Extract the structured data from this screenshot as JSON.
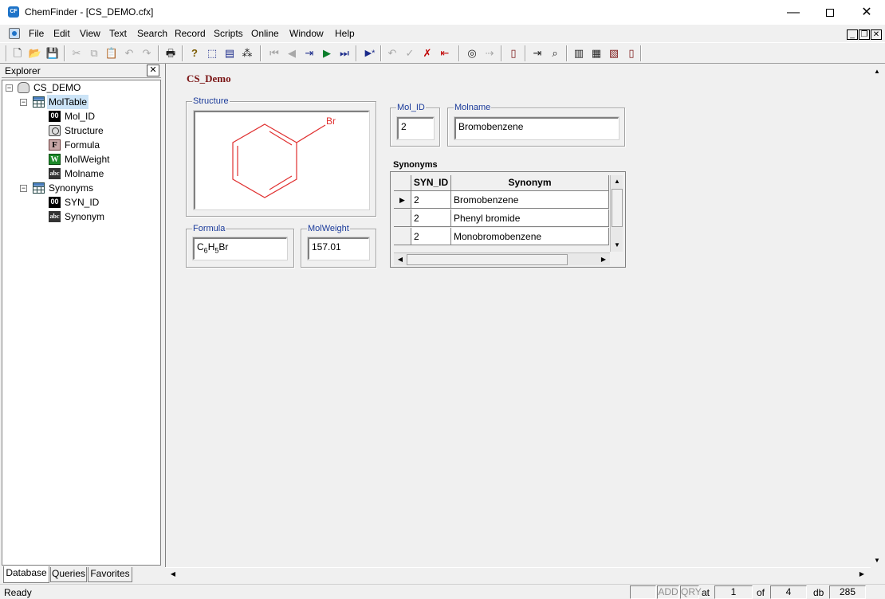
{
  "window": {
    "app_icon": "CF",
    "title": "ChemFinder - [CS_DEMO.cfx]",
    "controls": {
      "minimize": "—",
      "close": "✕"
    }
  },
  "menu": [
    "File",
    "Edit",
    "View",
    "Text",
    "Search",
    "Record",
    "Scripts",
    "Online",
    "Window",
    "Help"
  ],
  "mdi_controls": {
    "minimize": "_",
    "restore": "❐",
    "close": "✕"
  },
  "toolbar": {
    "icons": [
      "new-icon",
      "open-icon",
      "save-icon",
      "cut-icon",
      "copy-icon",
      "paste-icon",
      "undo-icon",
      "redo-icon",
      "print-icon",
      "help-icon",
      "select-icon",
      "form-icon",
      "magic-wand-icon",
      "first-record-icon",
      "previous-record-icon",
      "goto-record-icon",
      "next-record-icon",
      "last-record-icon",
      "new-record-icon",
      "undo-changes-icon",
      "commit-icon",
      "delete-record-icon",
      "insert-icon",
      "find-icon",
      "find-next-icon",
      "list-icon",
      "query-icon",
      "browse-icon",
      "copy-form-icon",
      "paste-form-icon",
      "subform-icon",
      "report-icon"
    ],
    "glyphs": {
      "new": "🗋",
      "open": "📂",
      "save": "💾",
      "cut": "✂",
      "copy": "⧉",
      "paste": "📋",
      "undo": "↶",
      "redo": "↷",
      "print": "🖶",
      "help": "?",
      "select": "⬚",
      "form": "▤",
      "wand": "⁂",
      "first": "⏮",
      "previous": "◀",
      "goto": "⇥",
      "next": "▶",
      "last": "⏭",
      "new_record": "▶*",
      "undo_changes": "↶",
      "commit": "✓",
      "delete": "✗",
      "insert": "⇤",
      "find": "◎",
      "find_next": "⇢",
      "list": "▯",
      "query": "⇥",
      "browse": "⌕",
      "copy_form": "▥",
      "paste_form": "▦",
      "subform": "▧",
      "report": "▯"
    }
  },
  "explorer": {
    "title": "Explorer",
    "close": "✕",
    "tree": {
      "root": "CS_DEMO",
      "tables": [
        {
          "name": "MolTable",
          "fields": [
            {
              "label": "Mol_ID",
              "icon": "00"
            },
            {
              "label": "Structure",
              "icon": ""
            },
            {
              "label": "Formula",
              "icon": "F"
            },
            {
              "label": "MolWeight",
              "icon": "W"
            },
            {
              "label": "Molname",
              "icon": "abc"
            }
          ]
        },
        {
          "name": "Synonyms",
          "fields": [
            {
              "label": "SYN_ID",
              "icon": "00"
            },
            {
              "label": "Synonym",
              "icon": "abc"
            }
          ]
        }
      ]
    },
    "tabs": [
      "Database",
      "Queries",
      "Favorites"
    ]
  },
  "form": {
    "title": "CS_Demo",
    "structure": {
      "label": "Structure",
      "atom_label": "Br",
      "bond_color": "#e03030"
    },
    "mol_id": {
      "label": "Mol_ID",
      "value": "2"
    },
    "molname": {
      "label": "Molname",
      "value": "Bromobenzene"
    },
    "formula": {
      "label": "Formula",
      "C": "C",
      "c_sub": "6",
      "H": "H",
      "h_sub": "5",
      "rest": "Br"
    },
    "molweight": {
      "label": "MolWeight",
      "value": "157.01"
    },
    "synonyms": {
      "label": "Synonyms",
      "columns": [
        "SYN_ID",
        "Synonym"
      ],
      "rows": [
        {
          "syn_id": "2",
          "synonym": "Bromobenzene"
        },
        {
          "syn_id": "2",
          "synonym": "Phenyl bromide"
        },
        {
          "syn_id": "2",
          "synonym": "Monobromobenzene"
        }
      ],
      "current_row_marker": "▶"
    }
  },
  "status": {
    "text": "Ready",
    "add": "ADD",
    "qry": "QRY",
    "at_label": "at",
    "position": "1",
    "of_label": "of",
    "total": "4",
    "db_label": "db",
    "db_count": "285"
  },
  "colors": {
    "form_title": "#7a1414",
    "group_label": "#1a3a9a",
    "molecule": "#e03030",
    "selection": "#cce4f7"
  }
}
